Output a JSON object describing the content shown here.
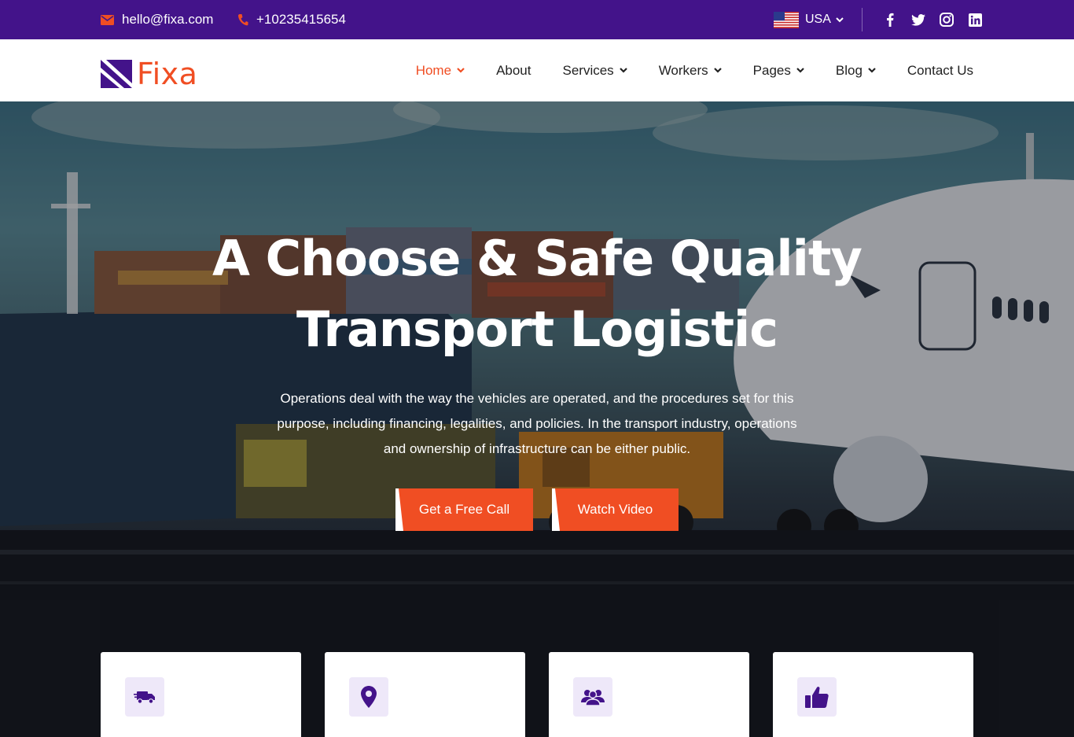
{
  "topbar": {
    "email": "hello@fixa.com",
    "phone": "+10235415654",
    "language": "USA",
    "background": "#43138a",
    "icon_accent": "#f04e23",
    "socials": [
      "facebook-icon",
      "twitter-icon",
      "instagram-icon",
      "linkedin-icon"
    ]
  },
  "header": {
    "logo_text": "Fixa",
    "nav": [
      {
        "label": "Home",
        "dropdown": true,
        "active": true
      },
      {
        "label": "About",
        "dropdown": false
      },
      {
        "label": "Services",
        "dropdown": true
      },
      {
        "label": "Workers",
        "dropdown": true
      },
      {
        "label": "Pages",
        "dropdown": true
      },
      {
        "label": "Blog",
        "dropdown": true
      },
      {
        "label": "Contact Us",
        "dropdown": false
      }
    ]
  },
  "hero": {
    "title_line1": "A Choose & Safe Quality",
    "title_line2": "Transport Logistic",
    "description": "Operations deal with the way the vehicles are operated, and the procedures set for this purpose, including financing, legalities, and policies. In the transport industry, operations and ownership of infrastructure can be either public.",
    "primary_button": "Get a Free Call",
    "secondary_button": "Watch Video"
  },
  "features": [
    {
      "icon": "truck-icon"
    },
    {
      "icon": "location-pin-icon"
    },
    {
      "icon": "team-icon"
    },
    {
      "icon": "thumbs-up-icon"
    }
  ],
  "colors": {
    "brand_purple": "#43138a",
    "accent_orange": "#f04e23"
  }
}
